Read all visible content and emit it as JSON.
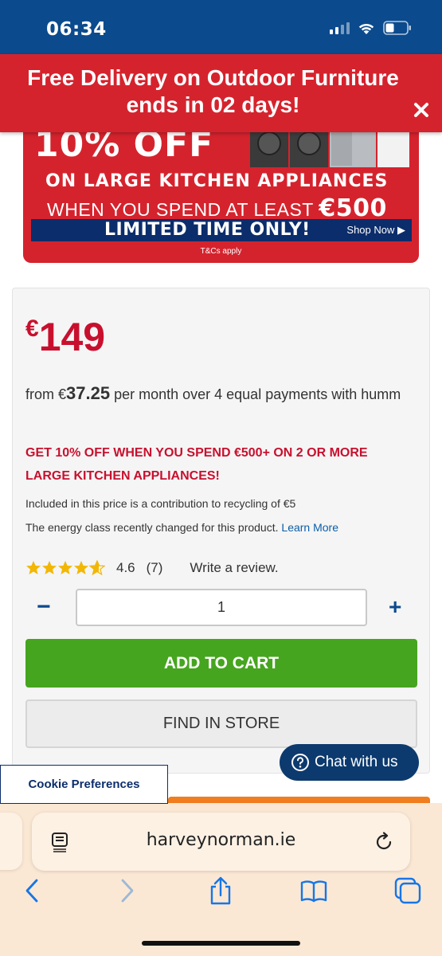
{
  "status_bar": {
    "time": "06:34"
  },
  "promo_banner": {
    "text": "Free Delivery on Outdoor Furniture ends in 02 days!"
  },
  "ad": {
    "headline": "10% OFF",
    "line1": "ON LARGE KITCHEN APPLIANCES",
    "line2": "WHEN YOU SPEND AT LEAST",
    "line2_amount": "€500",
    "strip_text": "LIMITED TIME ONLY!",
    "shop_now": "Shop Now ▶",
    "tcs": "T&Cs apply"
  },
  "product": {
    "price_symbol": "€",
    "price_value": "149",
    "finance_prefix": "from €",
    "finance_amount": "37.25",
    "finance_suffix": " per month over 4 equal payments with humm",
    "offer": "GET 10% OFF WHEN YOU SPEND €500+ ON 2 OR MORE LARGE KITCHEN APPLIANCES!",
    "recycling": "Included in this price is a contribution to recycling of €5",
    "energy_text": "The energy class recently changed for this product.",
    "energy_link": "Learn More",
    "rating": 4.6,
    "rating_label": "4.6",
    "review_count": "(7)",
    "write_review": "Write a review.",
    "quantity": "1",
    "minus": "−",
    "plus": "+",
    "add_to_cart": "ADD TO CART",
    "find_in_store": "FIND IN STORE"
  },
  "chat": {
    "label": "Chat with us"
  },
  "cookie": {
    "label": "Cookie Preferences"
  },
  "browser": {
    "url": "harveynorman.ie"
  },
  "colors": {
    "brand_blue": "#0b4a8d",
    "promo_red": "#d5232d",
    "price_red": "#c8102e",
    "cta_green": "#46a51f",
    "safari_bg": "#fbe8d4"
  }
}
